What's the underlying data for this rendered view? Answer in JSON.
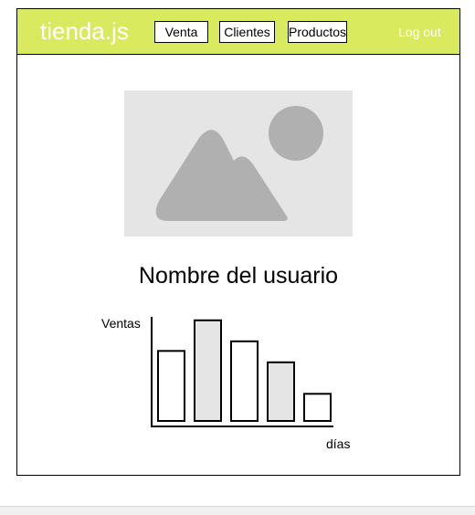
{
  "navbar": {
    "brand": "tienda.js",
    "items": [
      {
        "label": "Venta"
      },
      {
        "label": "Clientes"
      },
      {
        "label": "Productos"
      }
    ],
    "logout_label": "Log out",
    "color": "#d9ea5f"
  },
  "profile": {
    "avatar_icon": "image-placeholder-icon",
    "name": "Nombre del usuario"
  },
  "chart_data": {
    "type": "bar",
    "ylabel": "Ventas",
    "xlabel": "días",
    "categories": [
      "",
      "",
      "",
      "",
      ""
    ],
    "values": [
      80,
      115,
      91,
      67,
      31
    ],
    "fills": [
      "#ffffff",
      "#e5e5e5",
      "#ffffff",
      "#e5e5e5",
      "#ffffff"
    ],
    "ylim": [
      0,
      120
    ]
  }
}
